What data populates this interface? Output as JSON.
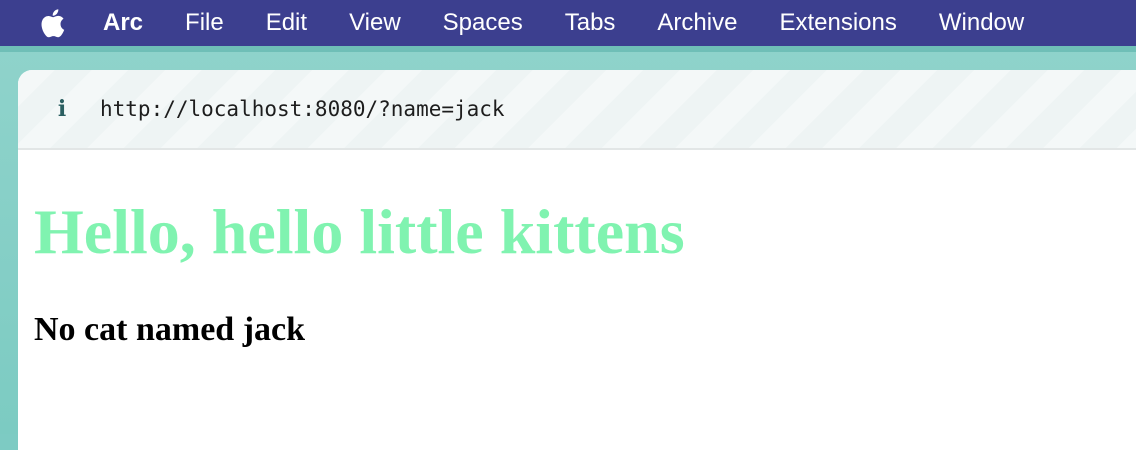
{
  "menubar": {
    "apple_icon": "apple-logo-icon",
    "app_name": "Arc",
    "items": [
      "File",
      "Edit",
      "View",
      "Spaces",
      "Tabs",
      "Archive",
      "Extensions",
      "Window"
    ]
  },
  "browser": {
    "url_info_icon": "info-icon",
    "url_info_glyph": "i",
    "url": "http://localhost:8080/?name=jack"
  },
  "page": {
    "heading": "Hello, hello little kittens",
    "message": "No cat named jack",
    "heading_color": "#80f3b0"
  },
  "colors": {
    "menubar_bg": "#3c3f8f",
    "frame_accent": "#7dcbc3"
  }
}
